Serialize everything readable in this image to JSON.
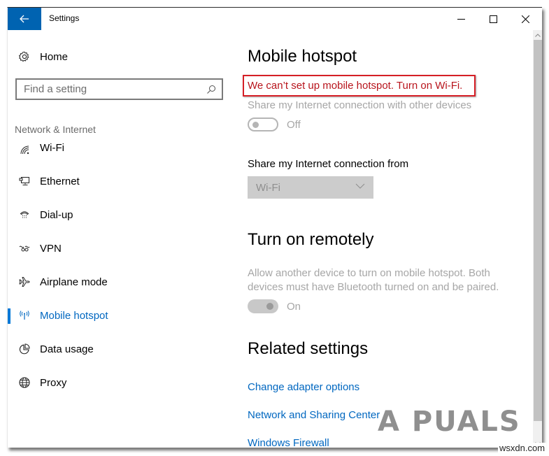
{
  "window": {
    "title": "Settings",
    "controls": {
      "minimize": "minimize",
      "maximize": "maximize",
      "close": "close"
    }
  },
  "sidebar": {
    "home_label": "Home",
    "search": {
      "placeholder": "Find a setting",
      "value": ""
    },
    "section_label": "Network & Internet",
    "items": [
      {
        "label": "Wi-Fi",
        "icon": "wifi-icon",
        "active": false
      },
      {
        "label": "Ethernet",
        "icon": "ethernet-icon",
        "active": false
      },
      {
        "label": "Dial-up",
        "icon": "dialup-icon",
        "active": false
      },
      {
        "label": "VPN",
        "icon": "vpn-icon",
        "active": false
      },
      {
        "label": "Airplane mode",
        "icon": "airplane-icon",
        "active": false
      },
      {
        "label": "Mobile hotspot",
        "icon": "hotspot-icon",
        "active": true
      },
      {
        "label": "Data usage",
        "icon": "data-usage-icon",
        "active": false
      },
      {
        "label": "Proxy",
        "icon": "globe-icon",
        "active": false
      }
    ]
  },
  "main": {
    "title": "Mobile hotspot",
    "error": "We can’t set up mobile hotspot. Turn on Wi-Fi.",
    "share_label": "Share my Internet connection with other devices",
    "share_toggle": {
      "state": "Off",
      "on": false,
      "enabled": false
    },
    "from_label": "Share my Internet connection from",
    "from_dropdown": {
      "value": "Wi-Fi",
      "enabled": false
    },
    "remote": {
      "title": "Turn on remotely",
      "description": "Allow another device to turn on mobile hotspot. Both devices must have Bluetooth turned on and be paired.",
      "toggle": {
        "state": "On",
        "on": true,
        "enabled": false
      }
    },
    "related": {
      "title": "Related settings",
      "links": [
        "Change adapter options",
        "Network and Sharing Center",
        "Windows Firewall"
      ]
    }
  },
  "watermarks": {
    "logo": "A PUALS",
    "site": "wsxdn.com"
  },
  "colors": {
    "accent": "#0078d7",
    "back_button": "#0063b1",
    "error_text": "#b8141c",
    "error_box": "#d61f26",
    "link": "#0067c0"
  }
}
